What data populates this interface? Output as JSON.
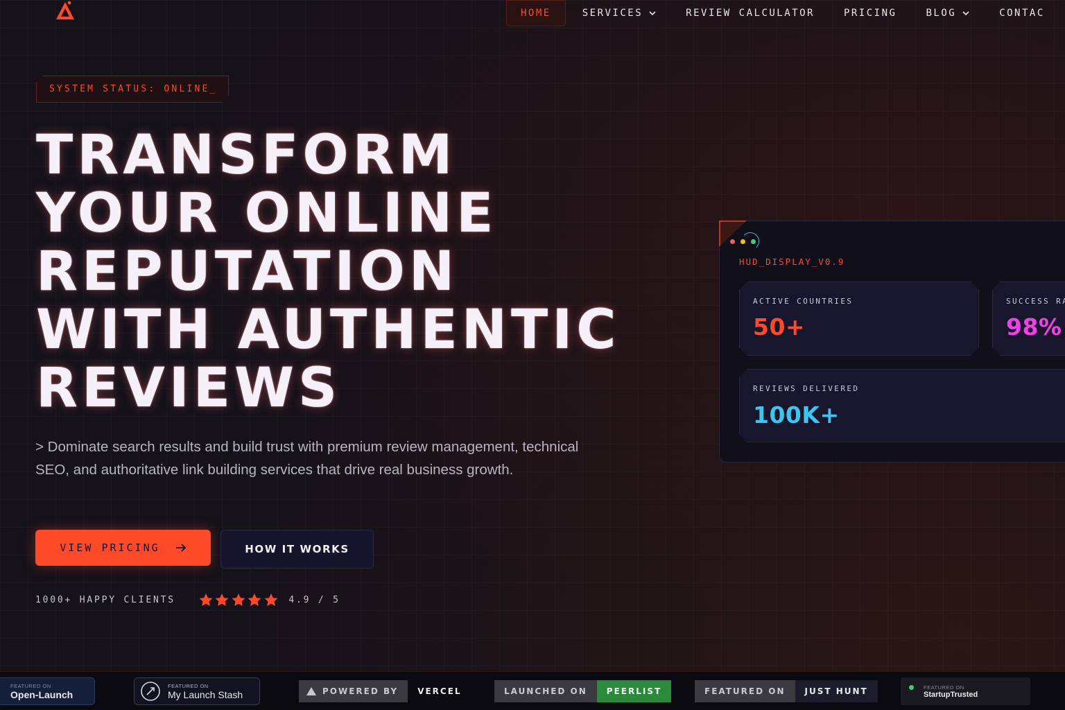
{
  "nav": {
    "items": [
      {
        "label": "HOME",
        "active": true
      },
      {
        "label": "SERVICES",
        "dropdown": true
      },
      {
        "label": "REVIEW CALCULATOR"
      },
      {
        "label": "PRICING"
      },
      {
        "label": "BLOG",
        "dropdown": true
      },
      {
        "label": "CONTAC"
      }
    ]
  },
  "hero": {
    "status": "SYSTEM STATUS: ONLINE_",
    "headline_lines": [
      "TRANSFORM",
      "YOUR ONLINE",
      "REPUTATION",
      "WITH AUTHENTIC",
      "REVIEWS"
    ],
    "subtext": "> Dominate search results and build trust with premium review management, technical SEO, and authoritative link building services that drive real business growth.",
    "primary_button": "VIEW PRICING",
    "secondary_button": "HOW IT WORKS",
    "clients": "1000+ HAPPY CLIENTS",
    "stars": 5,
    "rating": "4.9 / 5"
  },
  "hud": {
    "label": "HUD_DISPLAY_V0.9",
    "stats": [
      {
        "label": "ACTIVE COUNTRIES",
        "value": "50+",
        "color": "#ff4a2a"
      },
      {
        "label": "SUCCESS RA",
        "value": "98%",
        "color": "#f040e8"
      },
      {
        "label": "REVIEWS DELIVERED",
        "value": "100K+",
        "color": "#3fc4f0"
      }
    ]
  },
  "badges": {
    "open_launch": {
      "small": "FEATURED ON",
      "name": "Open-Launch"
    },
    "launch_stash": {
      "small": "FEATURED ON",
      "name": "My Launch Stash"
    },
    "vercel": {
      "left": "POWERED BY",
      "right": "VERCEL"
    },
    "peerlist": {
      "left": "LAUNCHED ON",
      "right": "PEERLIST"
    },
    "justhunt": {
      "left": "FEATURED ON",
      "right": "JUST HUNT"
    },
    "startup_trusted": {
      "small": "FEATURED ON",
      "name": "StartupTrusted"
    }
  },
  "colors": {
    "accent": "#ff4a2a",
    "background": "#15121a"
  }
}
